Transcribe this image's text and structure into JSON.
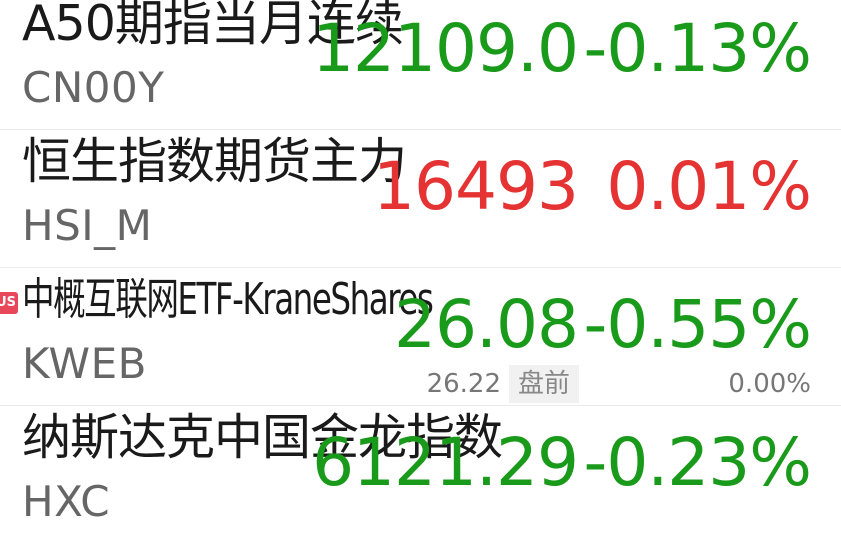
{
  "rows": [
    {
      "name": "A50期指当月连续",
      "code": "CN00Y",
      "price": "12109.0",
      "change": "-0.13%"
    },
    {
      "name": "恒生指数期货主力",
      "code": "HSI_M",
      "price": "16493",
      "change": "0.01%"
    },
    {
      "name": "中概互联网ETF-KraneShares",
      "code": "KWEB",
      "price": "26.08",
      "change": "-0.55%",
      "badge": "US",
      "pre_price": "26.22",
      "pre_label": "盘前",
      "pre_change": "0.00%"
    },
    {
      "name": "纳斯达克中国金龙指数",
      "code": "HXC",
      "price": "6121.29",
      "change": "-0.23%"
    }
  ],
  "colors": {
    "up": "#e53333",
    "down": "#1a9a1a"
  }
}
